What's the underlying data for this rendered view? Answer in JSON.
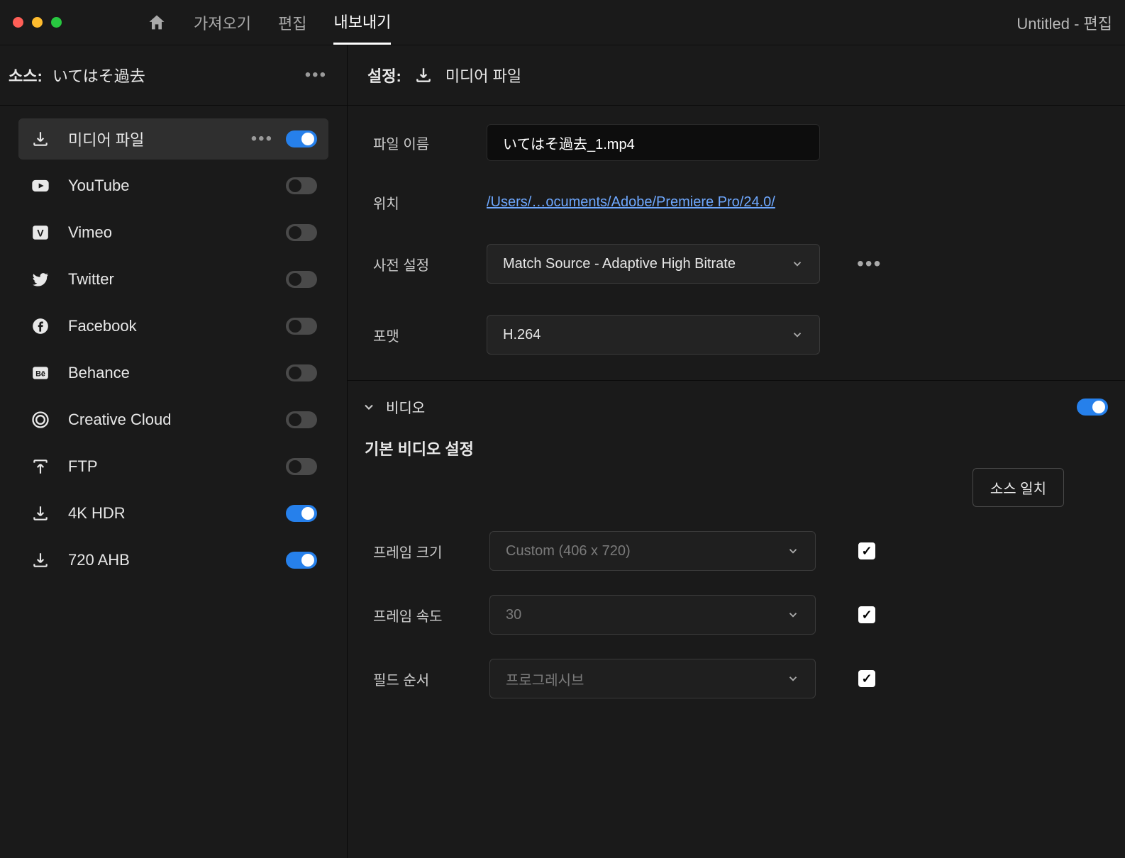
{
  "titlebar": {
    "tabs": [
      "가져오기",
      "편집",
      "내보내기"
    ],
    "active_tab": 2,
    "doc_title": "Untitled  - 편집"
  },
  "source": {
    "label": "소스:",
    "name": "いてはそ過去"
  },
  "destinations": [
    {
      "id": "media-file",
      "label": "미디어 파일",
      "on": true,
      "selected": true,
      "icon": "download"
    },
    {
      "id": "youtube",
      "label": "YouTube",
      "on": false,
      "icon": "youtube"
    },
    {
      "id": "vimeo",
      "label": "Vimeo",
      "on": false,
      "icon": "vimeo"
    },
    {
      "id": "twitter",
      "label": "Twitter",
      "on": false,
      "icon": "twitter"
    },
    {
      "id": "facebook",
      "label": "Facebook",
      "on": false,
      "icon": "facebook"
    },
    {
      "id": "behance",
      "label": "Behance",
      "on": false,
      "icon": "behance"
    },
    {
      "id": "creative-cloud",
      "label": "Creative Cloud",
      "on": false,
      "icon": "cc"
    },
    {
      "id": "ftp",
      "label": "FTP",
      "on": false,
      "icon": "upload"
    },
    {
      "id": "4k-hdr",
      "label": "4K HDR",
      "on": true,
      "icon": "download"
    },
    {
      "id": "720-ahb",
      "label": "720 AHB",
      "on": true,
      "icon": "download"
    }
  ],
  "settings": {
    "header_label": "설정:",
    "header_name": "미디어 파일",
    "filename_label": "파일 이름",
    "filename_value": "いてはそ過去_1.mp4",
    "location_label": "위치",
    "location_value": "/Users/…ocuments/Adobe/Premiere Pro/24.0/",
    "preset_label": "사전 설정",
    "preset_value": "Match Source - Adaptive High Bitrate",
    "format_label": "포맷",
    "format_value": "H.264"
  },
  "video": {
    "section_title": "비디오",
    "section_on": true,
    "subtitle": "기본 비디오 설정",
    "source_match_btn": "소스 일치",
    "rows": [
      {
        "label": "프레임 크기",
        "value": "Custom (406 x 720)",
        "checked": true,
        "disabled": true
      },
      {
        "label": "프레임 속도",
        "value": "30",
        "checked": true,
        "disabled": true
      },
      {
        "label": "필드 순서",
        "value": "프로그레시브",
        "checked": true,
        "disabled": true
      }
    ]
  }
}
